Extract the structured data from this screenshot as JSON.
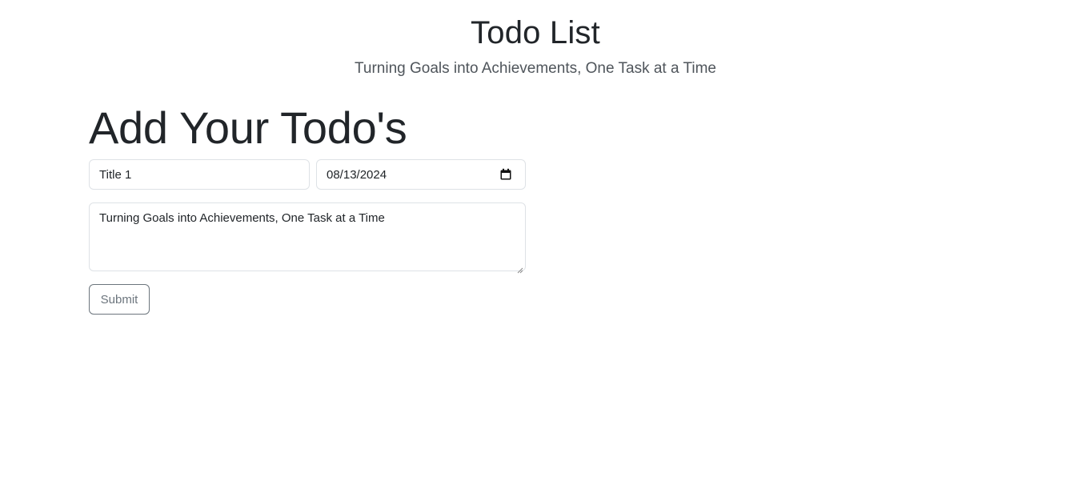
{
  "header": {
    "title": "Todo List",
    "subtitle": "Turning Goals into Achievements, One Task at a Time"
  },
  "form": {
    "heading": "Add Your Todo's",
    "title_field": {
      "value": "Title 1"
    },
    "date_field": {
      "value": "08/13/2024",
      "icon": "calendar-icon"
    },
    "description_field": {
      "value": "Turning Goals into Achievements, One Task at a Time"
    },
    "submit_label": "Submit"
  },
  "colors": {
    "text": "#212529",
    "subtitle": "#4f555b",
    "border": "#dee2e6",
    "button_outline": "#6c757d"
  }
}
